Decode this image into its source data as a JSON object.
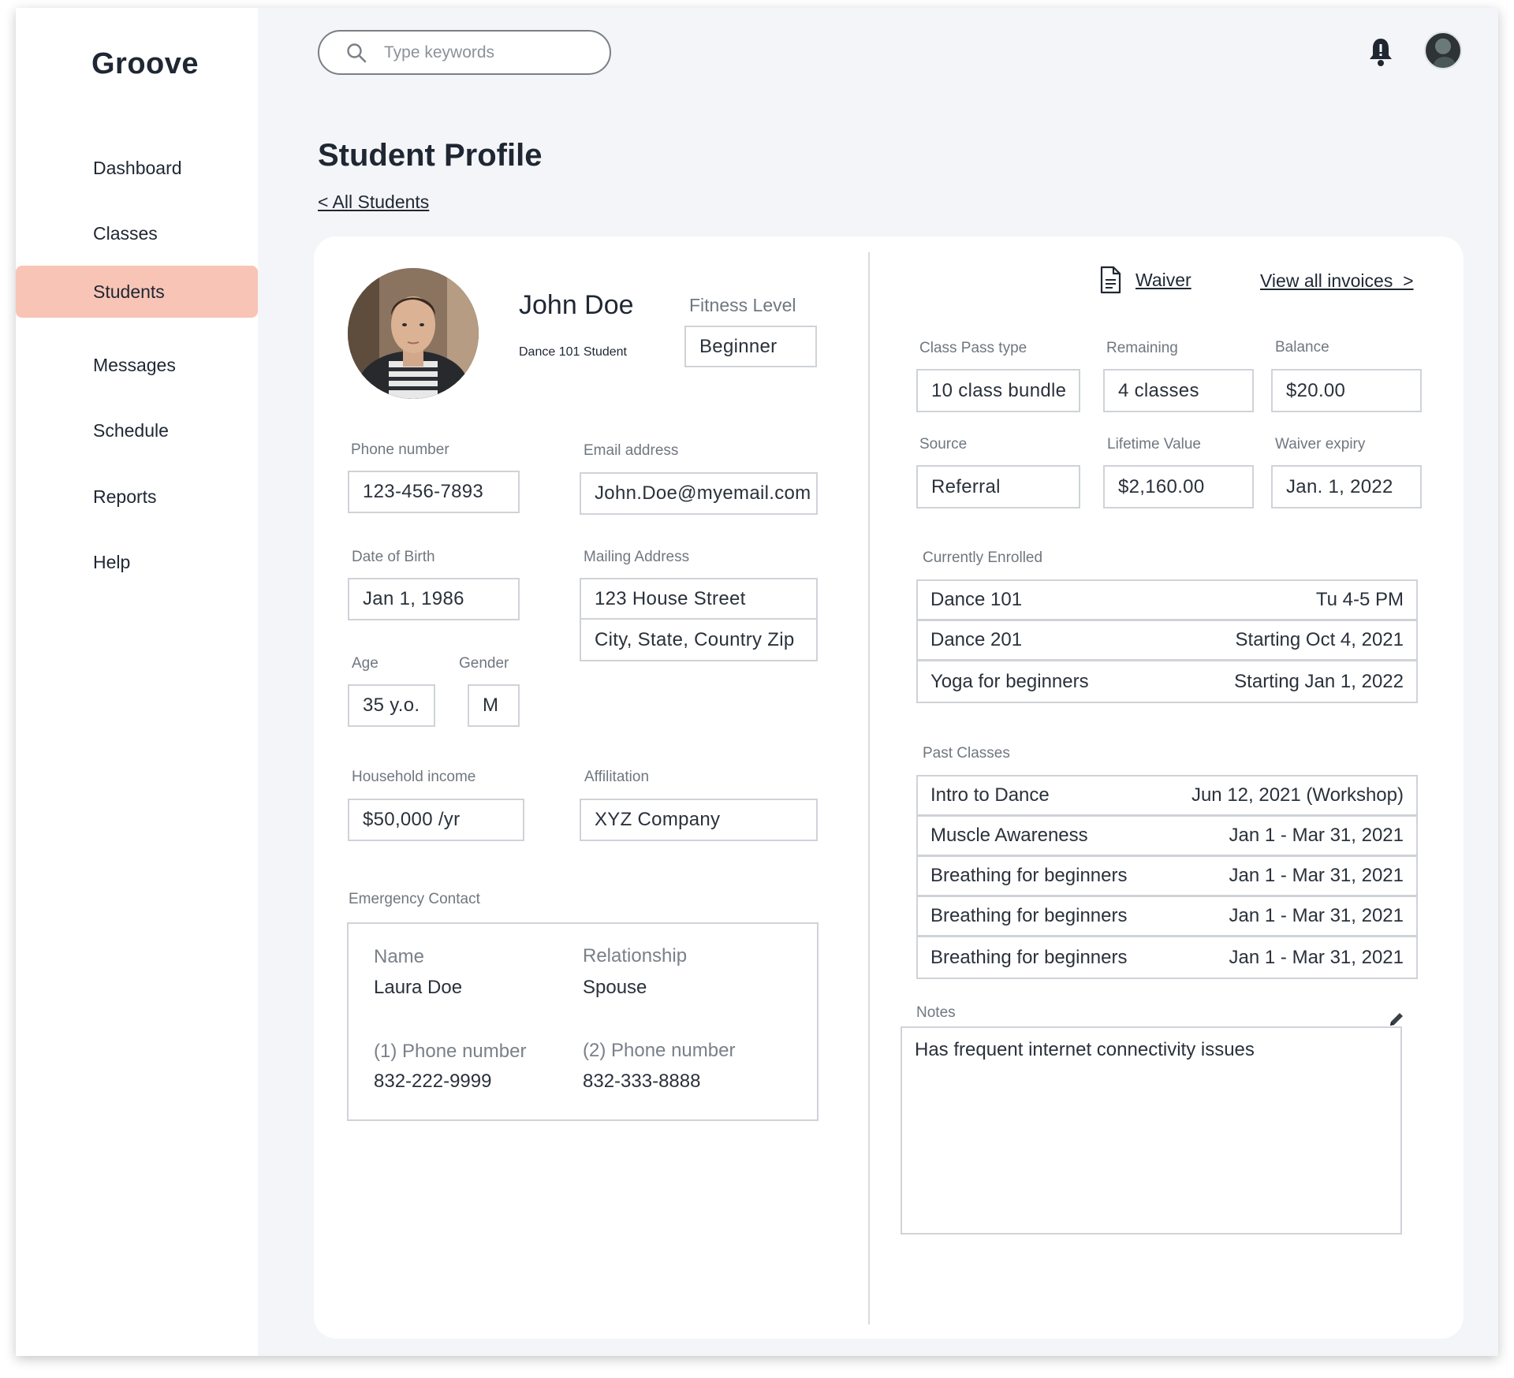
{
  "app": {
    "logo": "Groove"
  },
  "sidebar": {
    "items": [
      {
        "label": "Dashboard"
      },
      {
        "label": "Classes"
      },
      {
        "label": "Students"
      },
      {
        "label": "Messages"
      },
      {
        "label": "Schedule"
      },
      {
        "label": "Reports"
      },
      {
        "label": "Help"
      }
    ],
    "active": "Students"
  },
  "header": {
    "search_placeholder": "Type keywords",
    "icons": [
      "search-icon",
      "bell-icon",
      "user-avatar"
    ]
  },
  "page": {
    "title": "Student Profile",
    "back_link": "< All Students"
  },
  "profile": {
    "name": "John Doe",
    "subtitle": "Dance 101 Student",
    "fitness_level_label": "Fitness Level",
    "fitness_level": "Beginner",
    "phone_label": "Phone number",
    "phone": "123-456-7893",
    "email_label": "Email address",
    "email": "John.Doe@myemail.com",
    "dob_label": "Date of Birth",
    "dob": "Jan 1, 1986",
    "address_label": "Mailing Address",
    "address_line1": "123 House Street",
    "address_line2": "City, State, Country Zip",
    "age_label": "Age",
    "age": "35 y.o.",
    "gender_label": "Gender",
    "gender": "M",
    "income_label": "Household income",
    "income": "$50,000 /yr",
    "affiliation_label": "Affilitation",
    "affiliation": "XYZ Company"
  },
  "emergency": {
    "section_label": "Emergency Contact",
    "name_label": "Name",
    "name": "Laura Doe",
    "relationship_label": "Relationship",
    "relationship": "Spouse",
    "phone1_label": "(1) Phone number",
    "phone1": "832-222-9999",
    "phone2_label": "(2) Phone number",
    "phone2": "832-333-8888"
  },
  "account": {
    "waiver_link": "Waiver",
    "invoices_link": "View all invoices  >",
    "class_pass_label": "Class Pass type",
    "class_pass": "10 class bundle",
    "remaining_label": "Remaining",
    "remaining": "4 classes",
    "balance_label": "Balance",
    "balance": "$20.00",
    "source_label": "Source",
    "source": "Referral",
    "lifetime_label": "Lifetime Value",
    "lifetime": "$2,160.00",
    "waiver_expiry_label": "Waiver expiry",
    "waiver_expiry": "Jan. 1, 2022"
  },
  "enrolled": {
    "label": "Currently Enrolled",
    "rows": [
      {
        "name": "Dance 101",
        "when": "Tu 4-5 PM"
      },
      {
        "name": "Dance 201",
        "when": "Starting Oct 4, 2021"
      },
      {
        "name": "Yoga for beginners",
        "when": "Starting Jan 1, 2022"
      }
    ]
  },
  "past": {
    "label": "Past Classes",
    "rows": [
      {
        "name": "Intro to Dance",
        "when": "Jun 12, 2021 (Workshop)"
      },
      {
        "name": "Muscle Awareness",
        "when": "Jan 1 - Mar 31, 2021"
      },
      {
        "name": "Breathing for beginners",
        "when": "Jan 1 - Mar 31, 2021"
      },
      {
        "name": "Breathing for beginners",
        "when": "Jan 1 - Mar 31, 2021"
      },
      {
        "name": "Breathing for beginners",
        "when": "Jan 1 - Mar 31, 2021"
      }
    ]
  },
  "notes": {
    "label": "Notes",
    "text": "Has frequent internet connectivity issues"
  },
  "colors": {
    "sidebar_active": "#f8c4b6",
    "background": "#f4f5f8",
    "text": "#1f2733",
    "field_border": "#cfd3d8"
  }
}
